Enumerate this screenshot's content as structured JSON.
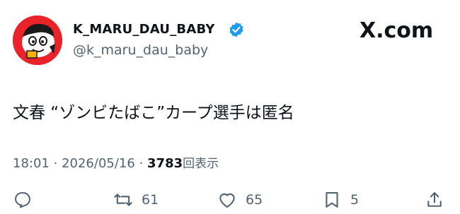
{
  "account": {
    "display_name": "K_MARU_DAU_BABY",
    "handle": "@k_maru_dau_baby",
    "verified": true
  },
  "brand": {
    "logo_text": "X.com"
  },
  "tweet": {
    "text": "文春 “ゾンビたばこ”カープ選手は匿名",
    "time": "18:01",
    "separator": "·",
    "date": "2026/05/16",
    "views_count": "3783",
    "views_label": "回表示"
  },
  "actions": {
    "retweets": "61",
    "likes": "65",
    "bookmarks": "5"
  },
  "colors": {
    "text": "#0f1419",
    "secondary": "#536471",
    "verified": "#1d9bf0",
    "avatar_bg": "#e8232a"
  }
}
